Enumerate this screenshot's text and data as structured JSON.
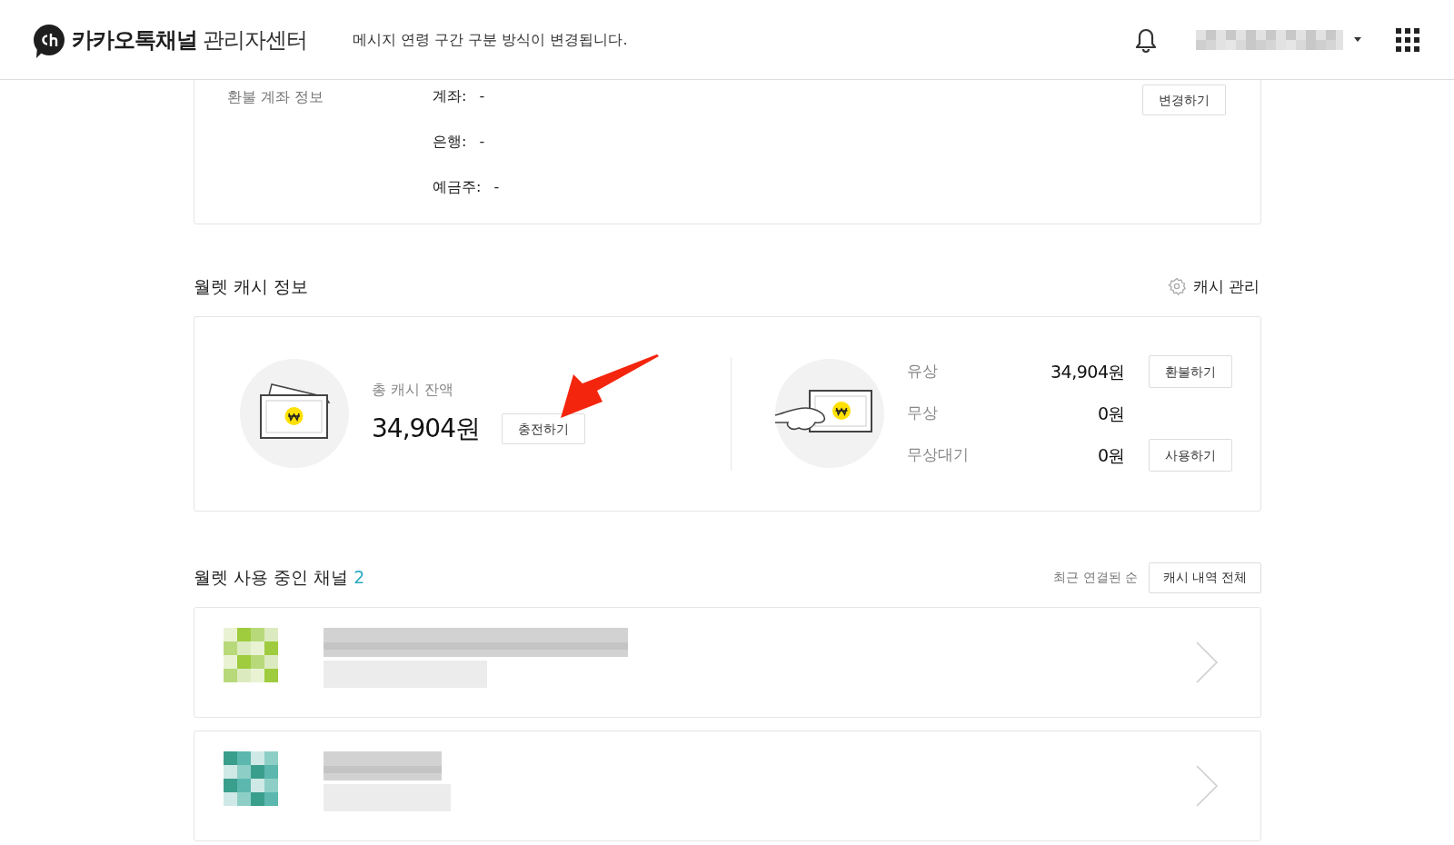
{
  "header": {
    "logo_text": "카카오톡채널",
    "logo_subtext": "관리자센터",
    "notice": "메시지 연령 구간 구분 방식이 변경됩니다."
  },
  "refund_account": {
    "title": "환불 계좌 정보",
    "button": "변경하기",
    "fields": [
      {
        "label": "계좌:",
        "value": "-"
      },
      {
        "label": "은행:",
        "value": "-"
      },
      {
        "label": "예금주:",
        "value": "-"
      }
    ]
  },
  "wallet_cash": {
    "title": "월렛 캐시 정보",
    "manage_link": "캐시 관리",
    "total_label": "총 캐시 잔액",
    "total_value": "34,904원",
    "charge_button": "충전하기",
    "breakdown": [
      {
        "label": "유상",
        "value": "34,904원",
        "button": "환불하기"
      },
      {
        "label": "무상",
        "value": "0원"
      },
      {
        "label": "무상대기",
        "value": "0원",
        "button": "사용하기"
      }
    ]
  },
  "channels": {
    "title": "월렛 사용 중인 채널",
    "count": "2",
    "sort": "최근 연결된 순",
    "history_button": "캐시 내역 전체"
  },
  "annotations": [
    {
      "kind": "arrow"
    }
  ]
}
